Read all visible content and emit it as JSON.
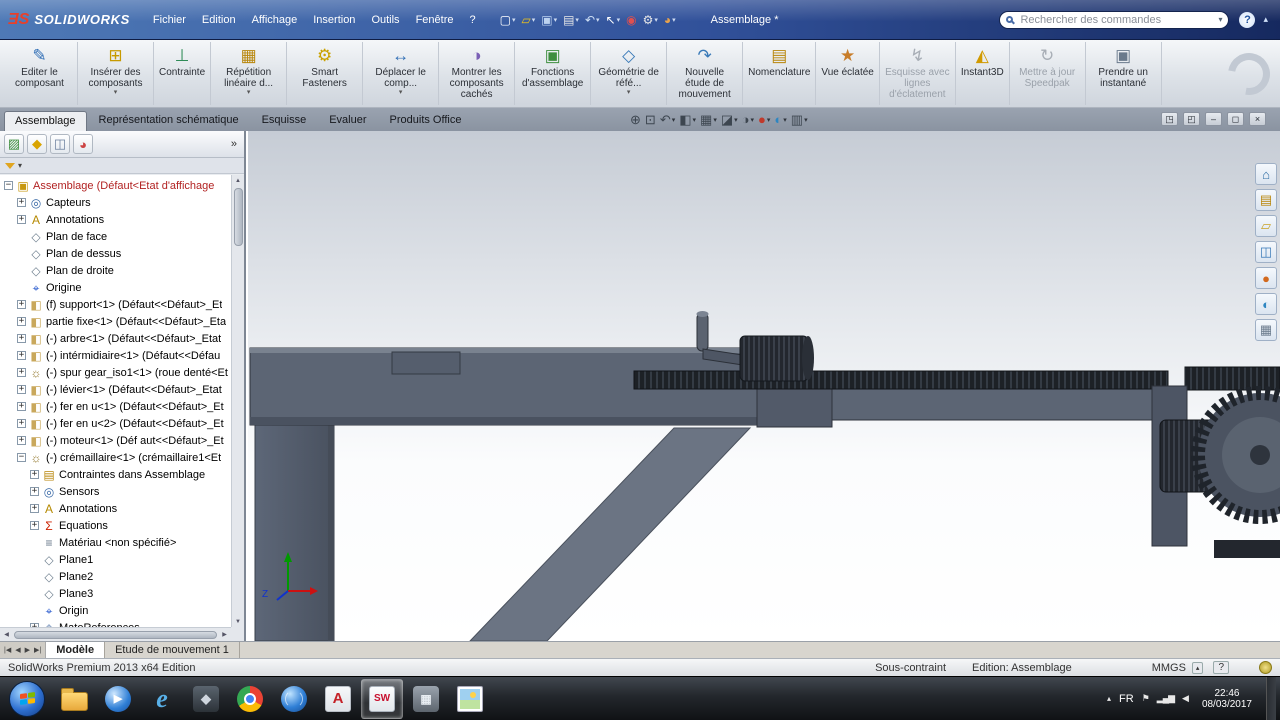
{
  "ui": {
    "caret_down": "▾"
  },
  "colors": {
    "titlebar_blue": "#31519a",
    "ribbon_gray": "#dde2e8",
    "tabstrip_slate": "#8a93a1",
    "model_slate": "#5c6574",
    "accent_red_logo": "#e8402a",
    "tree_root_red": "#b22222",
    "taskbar_dark": "#1d2126"
  },
  "titlebar": {
    "brand_mark": "ƎS",
    "brand": "SOLIDWORKS",
    "menus": [
      "Fichier",
      "Edition",
      "Affichage",
      "Insertion",
      "Outils",
      "Fenêtre",
      "?"
    ],
    "doc_title": "Assemblage *",
    "search": {
      "placeholder": "Rechercher des commandes"
    },
    "help_icon": "?",
    "collapse_icon": "▴",
    "quick_access": [
      {
        "name": "new-document-icon",
        "glyph": "▢",
        "color": "#ffffff",
        "caret": true
      },
      {
        "name": "open-icon",
        "glyph": "▱",
        "color": "#f0c419",
        "caret": true
      },
      {
        "name": "save-icon",
        "glyph": "▣",
        "color": "#bcd2f0",
        "caret": true
      },
      {
        "name": "print-icon",
        "glyph": "▤",
        "color": "#e8e8e8",
        "caret": true
      },
      {
        "name": "undo-icon",
        "glyph": "↶",
        "color": "#cfe0f5",
        "caret": true
      },
      {
        "name": "select-arrow-icon",
        "glyph": "↖",
        "color": "#ffffff",
        "caret": true
      },
      {
        "name": "rebuild-icon",
        "glyph": "◉",
        "color": "#e05050"
      },
      {
        "name": "options-icon",
        "glyph": "⚙",
        "color": "#e8e8e8",
        "caret": true
      },
      {
        "name": "appearance-palette-icon",
        "glyph": "◕",
        "color": "#e8a24c",
        "caret": true
      }
    ]
  },
  "ribbon": {
    "buttons": [
      {
        "label": "Editer le composant",
        "glyph": "✎",
        "color": "#2f6db5"
      },
      {
        "label": "Insérer des composants",
        "glyph": "⊞",
        "color": "#c79a00",
        "caret": true
      },
      {
        "label": "Contrainte",
        "glyph": "⊥",
        "color": "#2e8b57"
      },
      {
        "label": "Répétition linéaire d...",
        "glyph": "▦",
        "color": "#b8860b",
        "caret": true
      },
      {
        "label": "Smart Fasteners",
        "glyph": "⚙",
        "color": "#caa200"
      },
      {
        "label": "Déplacer le comp...",
        "glyph": "↔",
        "color": "#2f6db5",
        "caret": true
      },
      {
        "label": "Montrer les composants cachés",
        "glyph": "◑",
        "color": "#7a5fb5"
      },
      {
        "label": "Fonctions d'assemblage",
        "glyph": "▣",
        "color": "#3f8f3f"
      },
      {
        "label": "Géométrie de réfé...",
        "glyph": "◇",
        "color": "#3a7ab8",
        "caret": true
      },
      {
        "label": "Nouvelle étude de mouvement",
        "glyph": "↷",
        "color": "#3a7ab8"
      },
      {
        "label": "Nomenclature",
        "glyph": "▤",
        "color": "#b8860b"
      },
      {
        "label": "Vue éclatée",
        "glyph": "★",
        "color": "#c87d2a"
      },
      {
        "label": "Esquisse avec lignes d'éclatement",
        "glyph": "↯",
        "color": "#9aa0a8",
        "disabled": true
      },
      {
        "label": "Instant3D",
        "glyph": "◭",
        "color": "#d19a00"
      },
      {
        "label": "Mettre à jour Speedpak",
        "glyph": "↻",
        "color": "#9aa0a8",
        "disabled": true
      },
      {
        "label": "Prendre un instantané",
        "glyph": "▣",
        "color": "#6a7a8c"
      }
    ]
  },
  "command_tabs": {
    "items": [
      {
        "label": "Assemblage",
        "active": true
      },
      {
        "label": "Représentation schématique"
      },
      {
        "label": "Esquisse"
      },
      {
        "label": "Evaluer"
      },
      {
        "label": "Produits Office"
      }
    ]
  },
  "headsup": {
    "icons": [
      {
        "name": "zoom-fit-icon",
        "glyph": "⊕"
      },
      {
        "name": "zoom-area-icon",
        "glyph": "⊡"
      },
      {
        "name": "previous-view-icon",
        "glyph": "↶",
        "caret": true
      },
      {
        "name": "section-view-icon",
        "glyph": "◧",
        "caret": true
      },
      {
        "name": "view-orientation-icon",
        "glyph": "▦",
        "caret": true
      },
      {
        "name": "display-style-icon",
        "glyph": "◪",
        "caret": true
      },
      {
        "name": "hide-show-icon",
        "glyph": "◑",
        "caret": true
      },
      {
        "name": "edit-appearance-icon",
        "glyph": "●",
        "color": "#c0392b",
        "caret": true
      },
      {
        "name": "apply-scene-icon",
        "glyph": "◐",
        "color": "#2e86c1",
        "caret": true
      },
      {
        "name": "view-settings-icon",
        "glyph": "▥",
        "caret": true
      }
    ]
  },
  "doc_controls": {
    "icons": [
      {
        "name": "cascade-window-icon",
        "glyph": "◳"
      },
      {
        "name": "tile-window-icon",
        "glyph": "◰"
      },
      {
        "name": "minimize-window-icon",
        "glyph": "–"
      },
      {
        "name": "restore-window-icon",
        "glyph": "◻"
      },
      {
        "name": "close-window-icon",
        "glyph": "×"
      }
    ]
  },
  "panel": {
    "tabs": [
      {
        "name": "featuremanager-tab-icon",
        "glyph": "▨",
        "color": "#3f8f3f"
      },
      {
        "name": "propertymanager-tab-icon",
        "glyph": "◆",
        "color": "#d9a400"
      },
      {
        "name": "configurationmanager-tab-icon",
        "glyph": "◫",
        "color": "#6b7f9e"
      },
      {
        "name": "displaymanager-tab-icon",
        "glyph": "◕",
        "color": "#cc4444"
      }
    ],
    "overflow_icon": "»",
    "filter_caret": "▾"
  },
  "icon_map": {
    "assembly": {
      "glyph": "▣",
      "color": "#c79810"
    },
    "sensors": {
      "glyph": "◎",
      "color": "#3465a4"
    },
    "annotations": {
      "glyph": "A",
      "color": "#b58900"
    },
    "plane": {
      "glyph": "◇",
      "color": "#708090"
    },
    "origin": {
      "glyph": "⌖",
      "color": "#2255cc"
    },
    "part": {
      "glyph": "◧",
      "color": "#c9a85c"
    },
    "gear-part": {
      "glyph": "☼",
      "color": "#8a6d1a"
    },
    "mates-folder": {
      "glyph": "▤",
      "color": "#b8860b"
    },
    "equations": {
      "glyph": "Σ",
      "color": "#cc2200"
    },
    "material": {
      "glyph": "≡",
      "color": "#667788"
    },
    "matereferences": {
      "glyph": "◈",
      "color": "#5577aa"
    }
  },
  "feature_tree": {
    "items": [
      {
        "label": "Assemblage (Défaut<Etat d'affichage",
        "icon": "assembly",
        "indent": 0,
        "expander": "minus",
        "color": "#b22222"
      },
      {
        "label": "Capteurs",
        "icon": "sensors",
        "indent": 1,
        "expander": "plus"
      },
      {
        "label": "Annotations",
        "icon": "annotations",
        "indent": 1,
        "expander": "plus"
      },
      {
        "label": "Plan de face",
        "icon": "plane",
        "indent": 1
      },
      {
        "label": "Plan de dessus",
        "icon": "plane",
        "indent": 1
      },
      {
        "label": "Plan de droite",
        "icon": "plane",
        "indent": 1
      },
      {
        "label": "Origine",
        "icon": "origin",
        "indent": 1
      },
      {
        "label": "(f) support<1> (Défaut<<Défaut>_Et",
        "icon": "part",
        "indent": 1,
        "expander": "plus"
      },
      {
        "label": "partie fixe<1> (Défaut<<Défaut>_Eta",
        "icon": "part",
        "indent": 1,
        "expander": "plus"
      },
      {
        "label": "(-) arbre<1> (Défaut<<Défaut>_Etat",
        "icon": "part",
        "indent": 1,
        "expander": "plus"
      },
      {
        "label": "(-) intérmidiaire<1> (Défaut<<Défau",
        "icon": "part",
        "indent": 1,
        "expander": "plus"
      },
      {
        "label": "(-) spur gear_iso1<1> (roue denté<Et",
        "icon": "gear-part",
        "indent": 1,
        "expander": "plus"
      },
      {
        "label": "(-) lévier<1> (Défaut<<Défaut>_Etat",
        "icon": "part",
        "indent": 1,
        "expander": "plus"
      },
      {
        "label": "(-) fer en u<1> (Défaut<<Défaut>_Et",
        "icon": "part",
        "indent": 1,
        "expander": "plus"
      },
      {
        "label": "(-) fer en u<2> (Défaut<<Défaut>_Et",
        "icon": "part",
        "indent": 1,
        "expander": "plus"
      },
      {
        "label": "(-) moteur<1> (Déf aut<<Défaut>_Et",
        "icon": "part",
        "indent": 1,
        "expander": "plus"
      },
      {
        "label": "(-) crémaillaire<1> (crémaillaire1<Et",
        "icon": "gear-part",
        "indent": 1,
        "expander": "minus"
      },
      {
        "label": "Contraintes dans Assemblage",
        "icon": "mates-folder",
        "indent": 2,
        "expander": "plus"
      },
      {
        "label": "Sensors",
        "icon": "sensors",
        "indent": 2,
        "expander": "plus"
      },
      {
        "label": "Annotations",
        "icon": "annotations",
        "indent": 2,
        "expander": "plus"
      },
      {
        "label": "Equations",
        "icon": "equations",
        "indent": 2,
        "expander": "plus"
      },
      {
        "label": "Matériau <non spécifié>",
        "icon": "material",
        "indent": 2
      },
      {
        "label": "Plane1",
        "icon": "plane",
        "indent": 2
      },
      {
        "label": "Plane2",
        "icon": "plane",
        "indent": 2
      },
      {
        "label": "Plane3",
        "icon": "plane",
        "indent": 2
      },
      {
        "label": "Origin",
        "icon": "origin",
        "indent": 2
      },
      {
        "label": "MateReferences",
        "icon": "matereferences",
        "indent": 2,
        "expander": "plus"
      }
    ]
  },
  "viewport": {
    "triad_label": "Z",
    "task_pane_icons": [
      {
        "name": "resources-icon",
        "glyph": "⌂",
        "color": "#2e6da4"
      },
      {
        "name": "design-library-icon",
        "glyph": "▤",
        "color": "#b8860b"
      },
      {
        "name": "file-explorer-icon",
        "glyph": "▱",
        "color": "#caa227"
      },
      {
        "name": "view-palette-icon",
        "glyph": "◫",
        "color": "#3a7ab8"
      },
      {
        "name": "appearances-icon",
        "glyph": "●",
        "color": "#d2691e"
      },
      {
        "name": "scenes-icon",
        "glyph": "◐",
        "color": "#2e86c1"
      },
      {
        "name": "custom-properties-icon",
        "glyph": "▦",
        "color": "#6a7a8c"
      }
    ]
  },
  "model_tabs": {
    "nav": [
      "|◀",
      "◀",
      "▶",
      "▶|"
    ],
    "items": [
      {
        "label": "Modèle",
        "active": true
      },
      {
        "label": "Etude de mouvement 1"
      }
    ]
  },
  "statusbar": {
    "product": "SolidWorks Premium 2013 x64 Edition",
    "constraint": "Sous-contraint",
    "mode": "Edition: Assemblage",
    "units": "MMGS",
    "units_caret": "▴",
    "help": "?"
  },
  "taskbar": {
    "icons": [
      {
        "name": "explorer-icon",
        "kind": "folder"
      },
      {
        "name": "media-player-icon",
        "kind": "wmp",
        "glyph": "▶"
      },
      {
        "name": "internet-explorer-icon",
        "kind": "ie",
        "glyph": "e"
      },
      {
        "name": "app-icon",
        "kind": "darkapp",
        "glyph": "◆"
      },
      {
        "name": "chrome-icon",
        "kind": "chrome"
      },
      {
        "name": "edrawings-globe-icon",
        "kind": "globe"
      },
      {
        "name": "adobe-reader-icon",
        "kind": "adobe",
        "glyph": "A"
      },
      {
        "name": "solidworks-icon",
        "kind": "sw",
        "glyph": "SW",
        "active": true
      },
      {
        "name": "utility-icon",
        "kind": "gray",
        "glyph": "▦"
      },
      {
        "name": "photo-viewer-icon",
        "kind": "photo"
      }
    ],
    "tray": {
      "expand_icon": "▴",
      "language": "FR",
      "icons": [
        {
          "name": "action-center-icon",
          "glyph": "⚑"
        },
        {
          "name": "network-icon",
          "glyph": "▂▄▆"
        },
        {
          "name": "volume-icon",
          "glyph": "◀"
        }
      ],
      "time": "22:46",
      "date": "08/03/2017"
    }
  }
}
